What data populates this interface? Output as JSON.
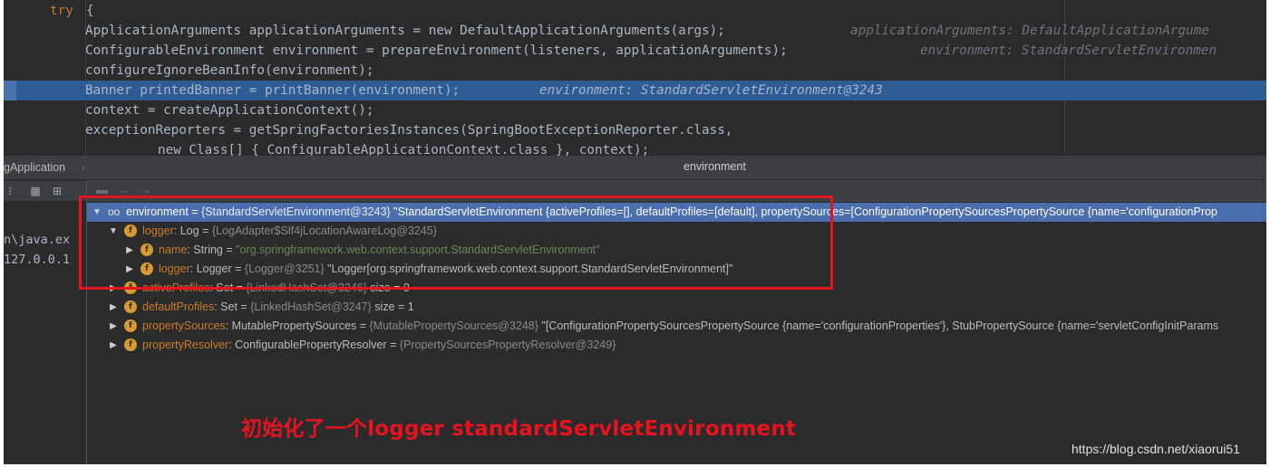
{
  "editor": {
    "lines": [
      {
        "pre": "try {",
        "kw": "try"
      },
      {
        "text": "ApplicationArguments applicationArguments = new DefaultApplicationArguments(args);",
        "comment": "applicationArguments: DefaultApplicationArgume"
      },
      {
        "text": "ConfigurableEnvironment environment = prepareEnvironment(listeners, applicationArguments);",
        "comment": "environment: StandardServletEnvironmen"
      },
      {
        "text": "configureIgnoreBeanInfo(environment);"
      },
      {
        "text": "Banner printedBanner = printBanner(environment);",
        "comment": "environment: StandardServletEnvironment@3243"
      },
      {
        "text": "context = createApplicationContext();"
      },
      {
        "text": "exceptionReporters = getSpringFactoriesInstances(SpringBootExceptionReporter.class,"
      },
      {
        "text": "new Class[] { ConfigurableApplicationContext.class }, context);"
      }
    ]
  },
  "panel": {
    "left_tab": "gApplication",
    "popup_title": "environment",
    "console": [
      "n\\java.ex",
      "127.0.0.1"
    ]
  },
  "tree": {
    "rows": [
      {
        "name": "environment",
        "eq": " = ",
        "ref": "{StandardServletEnvironment@3243}",
        "value": " \"StandardServletEnvironment {activeProfiles=[], defaultProfiles=[default], propertySources=[ConfigurationPropertySourcesPropertySource {name='configurationProp"
      },
      {
        "name": "logger",
        "type": "Log",
        "ref": "{LogAdapter$Slf4jLocationAwareLog@3245}"
      },
      {
        "name": "name",
        "type": "String",
        "value": "\"org.springframework.web.context.support.StandardServletEnvironment\""
      },
      {
        "name": "logger",
        "type": "Logger",
        "ref": "{Logger@3251}",
        "value": " \"Logger[org.springframework.web.context.support.StandardServletEnvironment]\""
      },
      {
        "name": "activeProfiles",
        "type": "Set",
        "ref": "{LinkedHashSet@3246}",
        "value": "  size = 0"
      },
      {
        "name": "defaultProfiles",
        "type": "Set",
        "ref": "{LinkedHashSet@3247}",
        "value": "  size = 1"
      },
      {
        "name": "propertySources",
        "type": "MutablePropertySources",
        "ref": "{MutablePropertySources@3248}",
        "value": " \"[ConfigurationPropertySourcesPropertySource {name='configurationProperties'}, StubPropertySource {name='servletConfigInitParams"
      },
      {
        "name": "propertyResolver",
        "type": "ConfigurablePropertyResolver",
        "ref": "{PropertySourcesPropertyResolver@3249}"
      }
    ]
  },
  "annotation": "初始化了一个logger    standardServletEnvironment",
  "watermark": "https://blog.csdn.net/xiaorui51",
  "colors": {
    "highlight": "#2d5b94",
    "selection": "#4b6eaf",
    "redbox": "#e8131f",
    "field_icon": "#d79a33"
  }
}
